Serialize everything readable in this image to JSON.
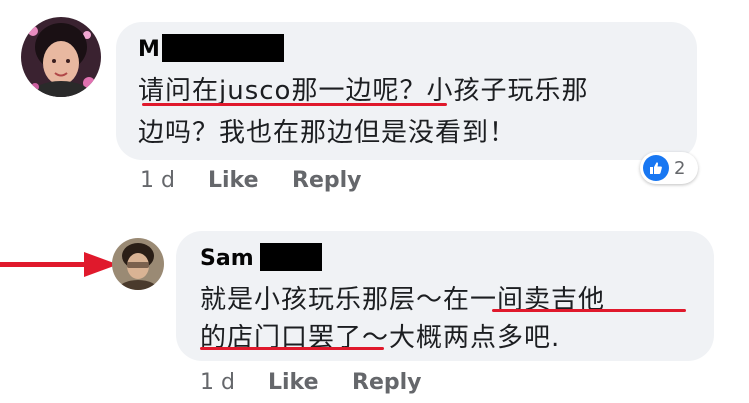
{
  "comments": [
    {
      "author_visible": "M",
      "lines": [
        "请问在jusco那一边呢？小孩子玩乐那",
        "边吗？我也在那边但是没看到！"
      ],
      "time": "1 d",
      "like_label": "Like",
      "reply_label": "Reply",
      "reaction_count": "2"
    },
    {
      "author_visible": "Sam",
      "lines": [
        "就是小孩玩乐那层～在一间卖吉他",
        "的店门口罢了～大概两点多吧."
      ],
      "time": "1 d",
      "like_label": "Like",
      "reply_label": "Reply"
    }
  ],
  "colors": {
    "bubble": "#f0f2f5",
    "underline": "#e0192c",
    "arrow": "#e0192c",
    "like_blue": "#1877f2"
  },
  "icons": [
    "thumbs-up-icon",
    "red-arrow"
  ]
}
